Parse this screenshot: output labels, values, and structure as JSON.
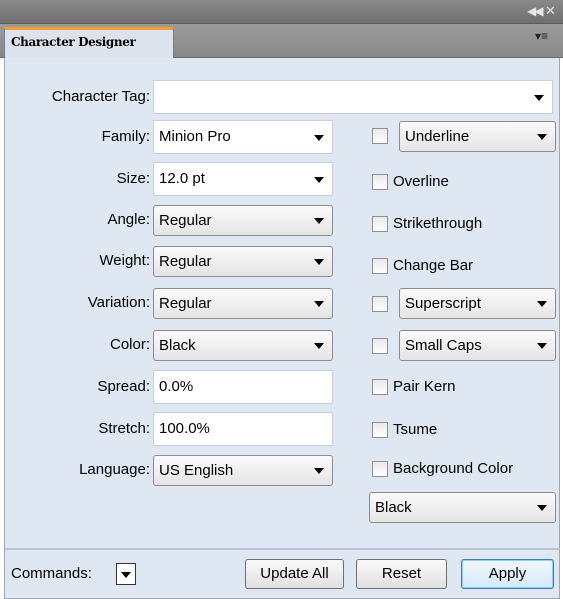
{
  "window": {
    "title_icons": [
      "collapse-icon",
      "close-icon"
    ],
    "tab_label": "Character Designer",
    "tab_menu_icon": "panel-menu-icon"
  },
  "form": {
    "character_tag": {
      "label": "Character Tag:",
      "value": ""
    },
    "family": {
      "label": "Family:",
      "value": "Minion Pro"
    },
    "size": {
      "label": "Size:",
      "value": "12.0 pt"
    },
    "angle": {
      "label": "Angle:",
      "value": "Regular"
    },
    "weight": {
      "label": "Weight:",
      "value": "Regular"
    },
    "variation": {
      "label": "Variation:",
      "value": "Regular"
    },
    "color": {
      "label": "Color:",
      "value": "Black"
    },
    "spread": {
      "label": "Spread:",
      "value": "0.0%"
    },
    "stretch": {
      "label": "Stretch:",
      "value": "100.0%"
    },
    "language": {
      "label": "Language:",
      "value": "US English"
    }
  },
  "options": {
    "underline": {
      "value": "Underline",
      "checked": false
    },
    "overline": {
      "label": "Overline",
      "checked": false
    },
    "strikethrough": {
      "label": "Strikethrough",
      "checked": false
    },
    "change_bar": {
      "label": "Change Bar",
      "checked": false
    },
    "superscript": {
      "value": "Superscript",
      "checked": false
    },
    "small_caps": {
      "value": "Small Caps",
      "checked": false
    },
    "pair_kern": {
      "label": "Pair Kern",
      "checked": false
    },
    "tsume": {
      "label": "Tsume",
      "checked": false
    },
    "background_color": {
      "label": "Background Color",
      "checked": false,
      "value": "Black"
    }
  },
  "footer": {
    "commands_label": "Commands:",
    "update_all": "Update All",
    "reset": "Reset",
    "apply": "Apply"
  },
  "colors": {
    "panel_bg": "#dfe7f2",
    "tab_accent": "#f0a030",
    "title_bar": "#7a7a7a"
  }
}
